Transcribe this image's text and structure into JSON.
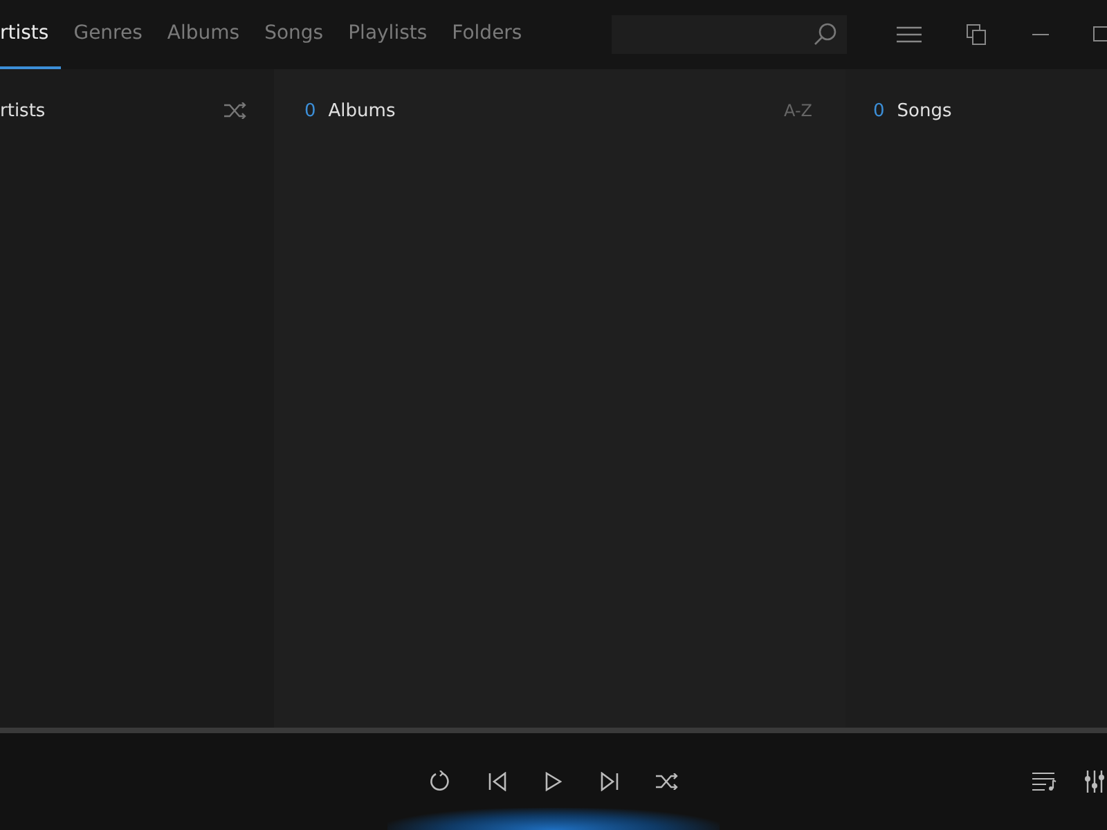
{
  "tabs": [
    {
      "label": "rtists",
      "selected": true
    },
    {
      "label": "Genres",
      "selected": false
    },
    {
      "label": "Albums",
      "selected": false
    },
    {
      "label": "Songs",
      "selected": false
    },
    {
      "label": "Playlists",
      "selected": false
    },
    {
      "label": "Folders",
      "selected": false
    }
  ],
  "columns": [
    {
      "title": "rtists",
      "action": {
        "kind": "shuffle"
      }
    },
    {
      "count": "0",
      "title": "Albums",
      "action": {
        "kind": "text",
        "label": "A-Z"
      }
    },
    {
      "count": "0",
      "title": "Songs"
    }
  ]
}
